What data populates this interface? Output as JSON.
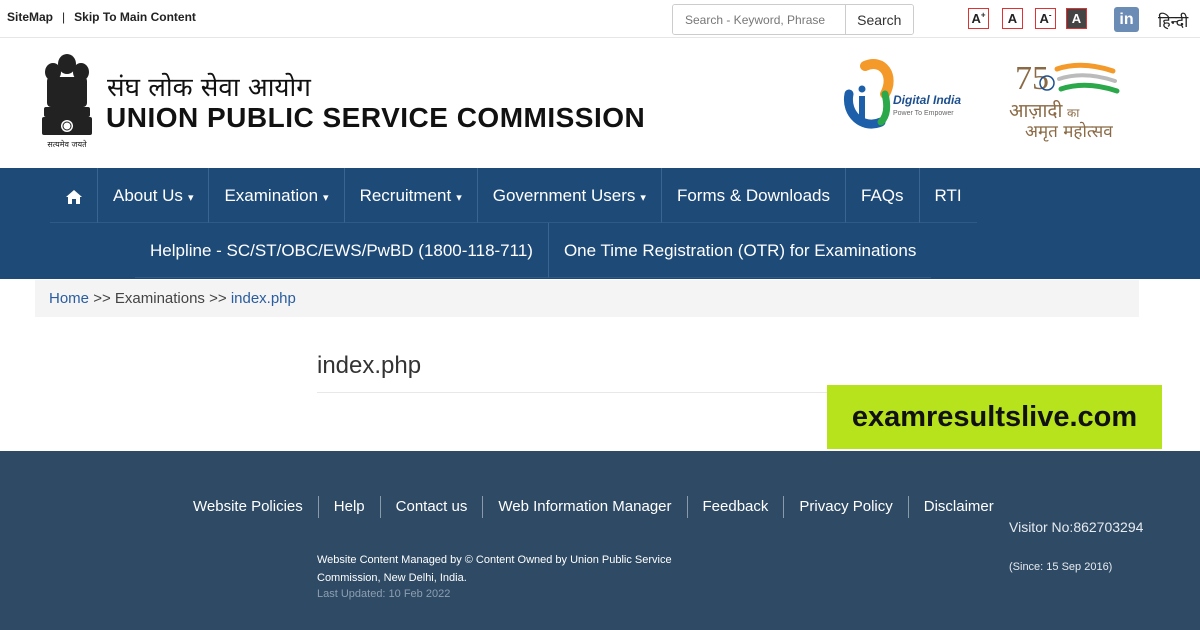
{
  "topbar": {
    "sitemap": "SiteMap",
    "separator": "|",
    "skip": "Skip To Main Content",
    "search_placeholder": "Search - Keyword, Phrase",
    "search_button": "Search",
    "font_increase": "A",
    "font_normal": "A",
    "font_decrease": "A",
    "high_contrast": "A",
    "linkedin_icon": "linkedin-icon",
    "language": "हिन्दी"
  },
  "header": {
    "title_hindi": "संघ लोक सेवा आयोग",
    "title_english": "UNION PUBLIC SERVICE COMMISSION",
    "emblem_caption": "सत्यमेव जयते",
    "digital_india": "Digital India",
    "digital_india_tagline": "Power To Empower",
    "azadi_75": "75",
    "azadi_line1": "आज़ादी",
    "azadi_ka": "का",
    "azadi_line2": "अमृत महोत्सव"
  },
  "nav": {
    "home_icon": "home-icon",
    "row1": [
      {
        "label": "About Us",
        "dropdown": true
      },
      {
        "label": "Examination",
        "dropdown": true
      },
      {
        "label": "Recruitment",
        "dropdown": true
      },
      {
        "label": "Government Users",
        "dropdown": true
      },
      {
        "label": "Forms & Downloads",
        "dropdown": false
      },
      {
        "label": "FAQs",
        "dropdown": false
      },
      {
        "label": "RTI",
        "dropdown": false
      }
    ],
    "row2": [
      {
        "label": "Helpline - SC/ST/OBC/EWS/PwBD (1800-118-711)"
      },
      {
        "label": "One Time Registration (OTR) for Examinations"
      }
    ]
  },
  "breadcrumb": {
    "home": "Home",
    "sep1": ">>",
    "examinations": "Examinations",
    "sep2": ">>",
    "current": "index.php"
  },
  "main": {
    "title": "index.php"
  },
  "watermark": "examresultslive.com",
  "footer": {
    "links": [
      "Website Policies",
      "Help",
      "Contact us",
      "Web Information Manager",
      "Feedback",
      "Privacy Policy",
      "Disclaimer"
    ],
    "managed_by": "Website Content Managed by © Content Owned by Union Public Service Commission, New Delhi, India.",
    "last_updated": "Last Updated: 10 Feb 2022",
    "visitor": "Visitor No:862703294",
    "since": "(Since: 15 Sep 2016)"
  },
  "colors": {
    "nav_bg": "#1e4a78",
    "footer_bg": "#2e4a64",
    "link_blue": "#2a5d9f",
    "watermark_bg": "#b7e31d"
  }
}
